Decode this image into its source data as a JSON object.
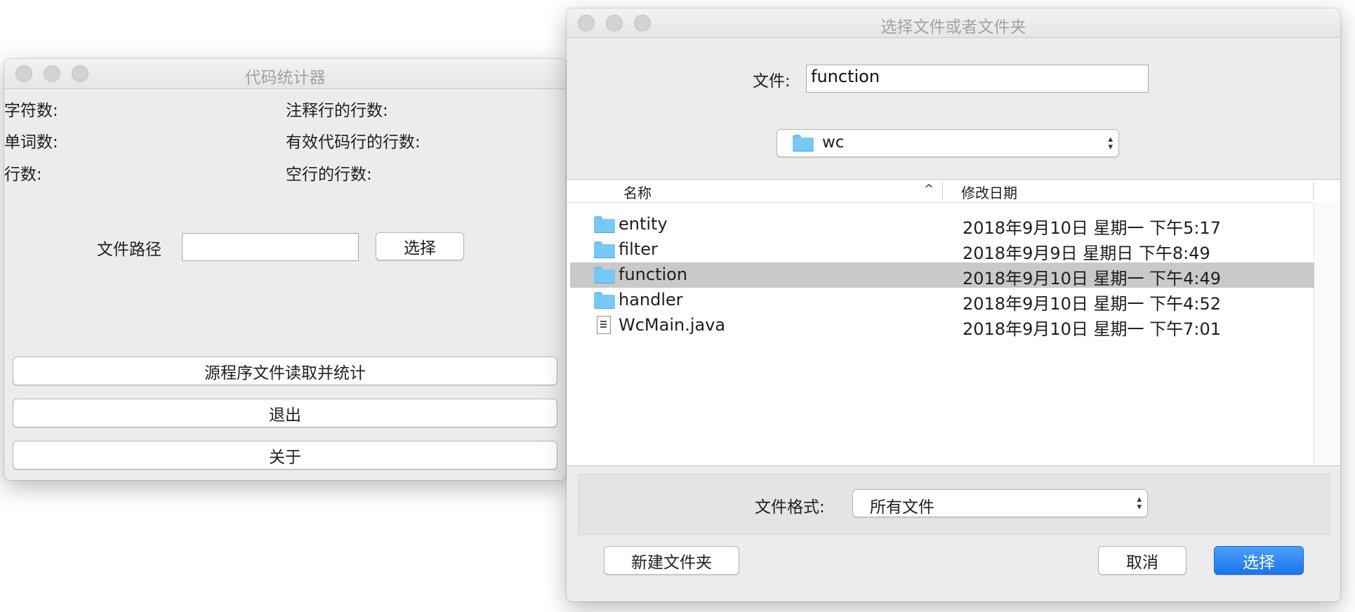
{
  "counter_window": {
    "title": "代码统计器",
    "stats": {
      "chars_label": "字符数:",
      "comment_lines_label": "注释行的行数:",
      "words_label": "单词数:",
      "code_lines_label": "有效代码行的行数:",
      "lines_label": "行数:",
      "blank_lines_label": "空行的行数:"
    },
    "path_label": "文件路径",
    "path_value": "",
    "select_button": "选择",
    "read_button": "源程序文件读取并统计",
    "exit_button": "退出",
    "about_button": "关于"
  },
  "chooser_window": {
    "title": "选择文件或者文件夹",
    "file_label": "文件:",
    "file_value": "function",
    "location": "wc",
    "columns": {
      "name": "名称",
      "date": "修改日期"
    },
    "files": [
      {
        "name": "entity",
        "date": "2018年9月10日 星期一 下午5:17",
        "kind": "folder",
        "selected": false
      },
      {
        "name": "filter",
        "date": "2018年9月9日 星期日 下午8:49",
        "kind": "folder",
        "selected": false
      },
      {
        "name": "function",
        "date": "2018年9月10日 星期一 下午4:49",
        "kind": "folder",
        "selected": true
      },
      {
        "name": "handler",
        "date": "2018年9月10日 星期一 下午4:52",
        "kind": "folder",
        "selected": false
      },
      {
        "name": "WcMain.java",
        "date": "2018年9月10日 星期一 下午7:01",
        "kind": "file",
        "selected": false
      }
    ],
    "format_label": "文件格式:",
    "format_value": "所有文件",
    "new_folder_button": "新建文件夹",
    "cancel_button": "取消",
    "choose_button": "选择"
  },
  "colors": {
    "accent": "#1c76ee",
    "selection": "#c9c9c9",
    "folder": "#78c8f6"
  }
}
